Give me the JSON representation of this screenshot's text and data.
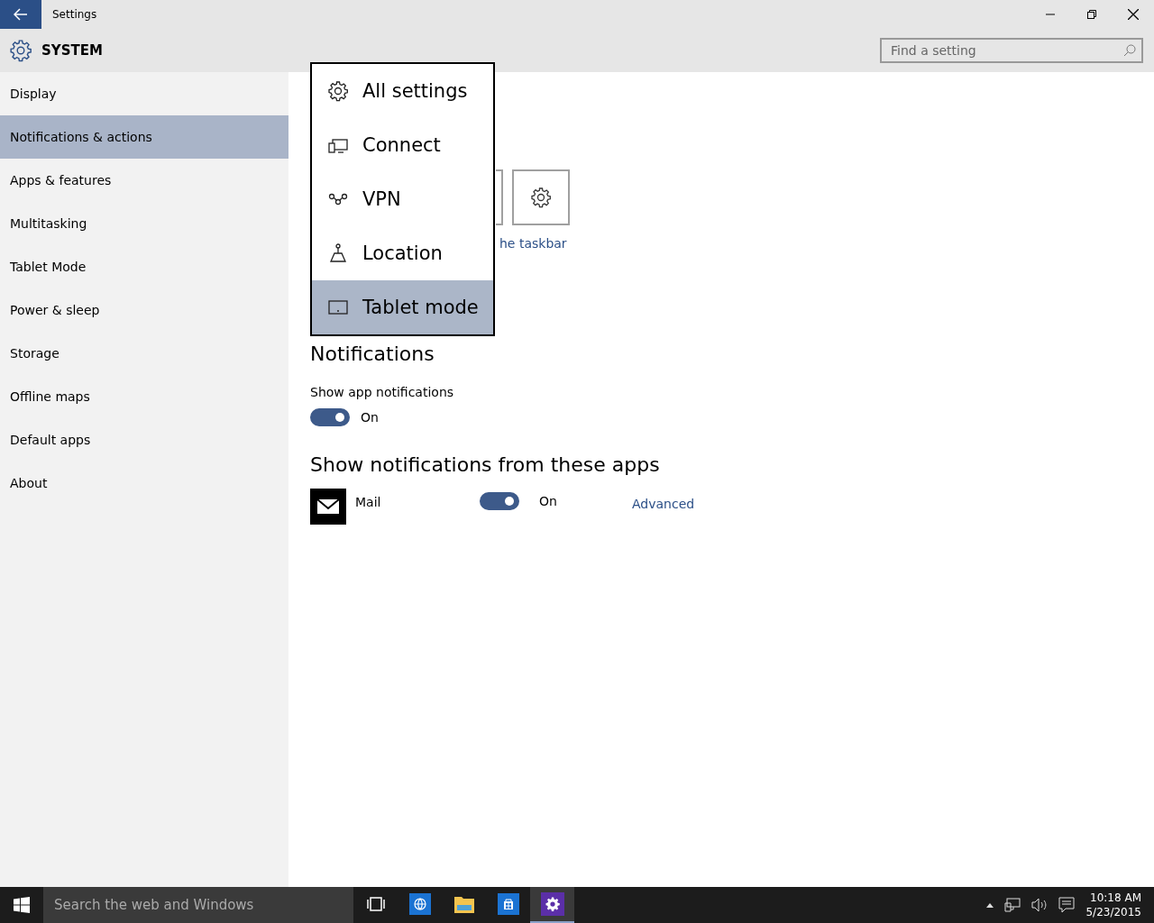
{
  "window": {
    "title": "Settings"
  },
  "header": {
    "title": "SYSTEM",
    "search": {
      "placeholder": "Find a setting"
    }
  },
  "sidebar": {
    "items": [
      {
        "label": "Display",
        "selected": false
      },
      {
        "label": "Notifications & actions",
        "selected": true
      },
      {
        "label": "Apps & features",
        "selected": false
      },
      {
        "label": "Multitasking",
        "selected": false
      },
      {
        "label": "Tablet Mode",
        "selected": false
      },
      {
        "label": "Power & sleep",
        "selected": false
      },
      {
        "label": "Storage",
        "selected": false
      },
      {
        "label": "Offline maps",
        "selected": false
      },
      {
        "label": "Default apps",
        "selected": false
      },
      {
        "label": "About",
        "selected": false
      }
    ]
  },
  "quick_actions": {
    "tiles": [
      {
        "kind": "partial"
      },
      {
        "kind": "gear"
      }
    ],
    "link": "he taskbar"
  },
  "popup": {
    "items": [
      {
        "kind": "gear",
        "label": "All settings",
        "selected": false
      },
      {
        "kind": "connect",
        "label": "Connect",
        "selected": false
      },
      {
        "kind": "vpn",
        "label": "VPN",
        "selected": false
      },
      {
        "kind": "location",
        "label": "Location",
        "selected": false
      },
      {
        "kind": "tablet",
        "label": "Tablet mode",
        "selected": true
      }
    ]
  },
  "notifications": {
    "heading": "Notifications",
    "setting": "Show app notifications",
    "on": true,
    "state": "On"
  },
  "apps_section": {
    "heading": "Show notifications from these apps",
    "apps": [
      {
        "name": "Mail",
        "on": true,
        "state": "On",
        "link": "Advanced"
      }
    ]
  },
  "taskbar": {
    "search": {
      "placeholder": "Search the web and Windows"
    },
    "apps": [
      {
        "kind": "taskview",
        "selected": false
      },
      {
        "kind": "browser",
        "selected": false
      },
      {
        "kind": "folder",
        "selected": false
      },
      {
        "kind": "store",
        "selected": false
      },
      {
        "kind": "settings",
        "selected": true
      }
    ],
    "time": "10:18 AM",
    "date": "5/23/2015"
  }
}
